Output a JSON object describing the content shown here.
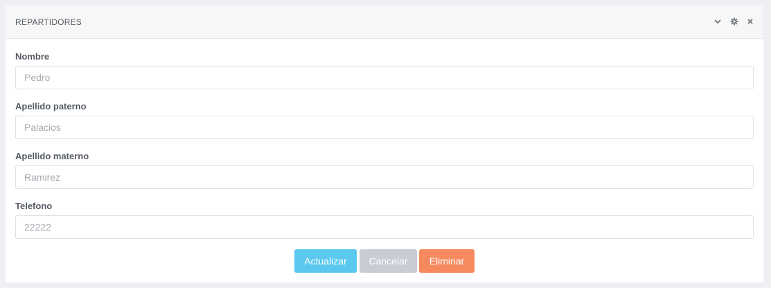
{
  "panel": {
    "title": "REPARTIDORES",
    "tools": {
      "collapse_icon": "chevron-down-icon",
      "settings_icon": "gear-icon",
      "close_icon": "close-icon"
    }
  },
  "form": {
    "fields": [
      {
        "label": "Nombre",
        "value": "",
        "placeholder": "Pedro"
      },
      {
        "label": "Apellido paterno",
        "value": "",
        "placeholder": "Palacios"
      },
      {
        "label": "Apellido materno",
        "value": "",
        "placeholder": "Ramirez"
      },
      {
        "label": "Telefono",
        "value": "",
        "placeholder": "22222"
      }
    ]
  },
  "actions": {
    "update_label": "Actualizar",
    "cancel_label": "Cancelar",
    "delete_label": "Eliminar"
  },
  "colors": {
    "update": "#5ac8ef",
    "cancel": "#c8ccd3",
    "delete": "#f6895e"
  }
}
